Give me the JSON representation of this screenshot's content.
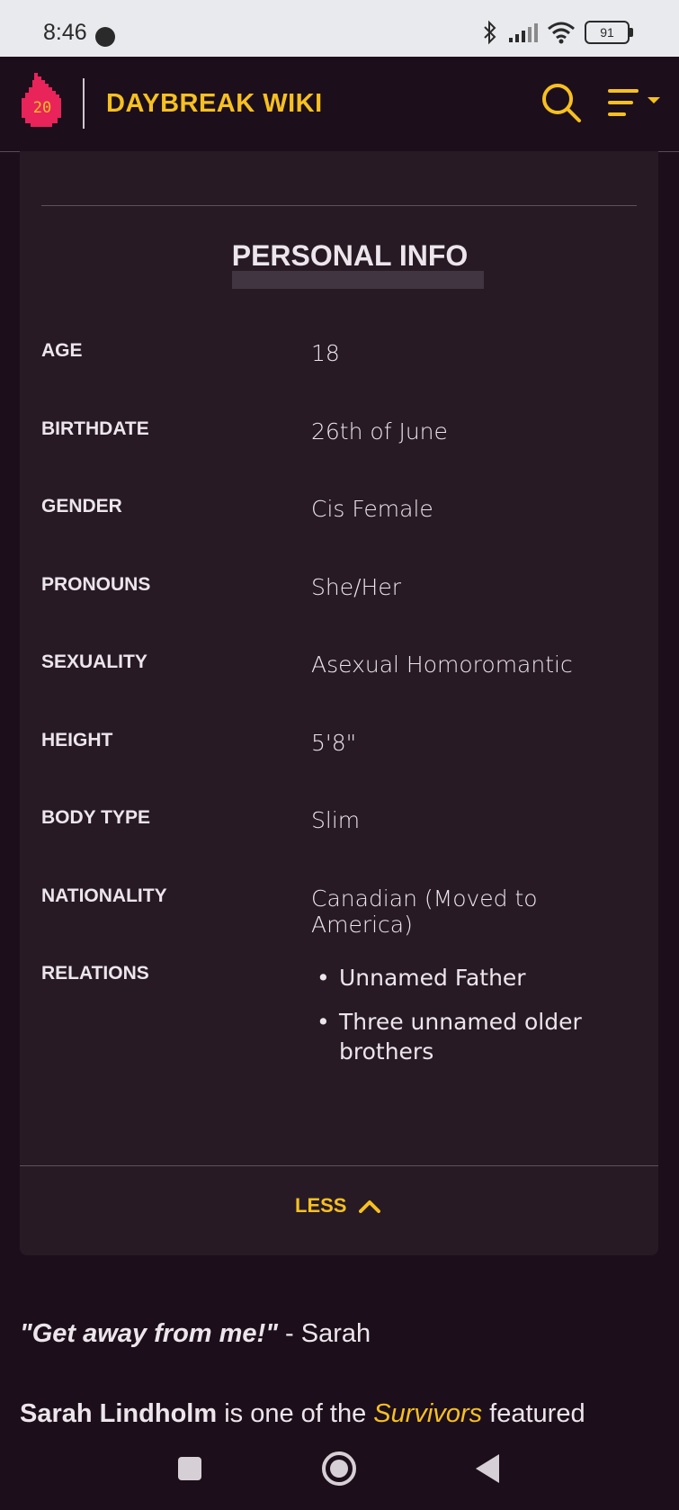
{
  "status": {
    "time": "8:46",
    "battery": "91"
  },
  "header": {
    "brand": "DAYBREAK WIKI",
    "logo_text": "20"
  },
  "infobox": {
    "title": "PERSONAL INFO",
    "rows": [
      {
        "label": "AGE",
        "value": "18"
      },
      {
        "label": "BIRTHDATE",
        "value": "26th of June"
      },
      {
        "label": "GENDER",
        "value": "Cis Female"
      },
      {
        "label": "PRONOUNS",
        "value": "She/Her"
      },
      {
        "label": "SEXUALITY",
        "value": "Asexual Homoromantic"
      },
      {
        "label": "HEIGHT",
        "value": "5'8\""
      },
      {
        "label": "BODY TYPE",
        "value": "Slim"
      },
      {
        "label": "NATIONALITY",
        "value": "Canadian (Moved to America)"
      }
    ],
    "relations_label": "RELATIONS",
    "relations": [
      "Unnamed Father",
      "Three unnamed older brothers"
    ],
    "less_label": "LESS"
  },
  "article": {
    "quote_text": "\"Get away from me!\"",
    "quote_attribution": " - Sarah",
    "intro_name": "Sarah Lindholm",
    "intro_mid": " is one of the ",
    "intro_link": "Survivors",
    "intro_end": " featured"
  },
  "colors": {
    "accent": "#f6c022",
    "background": "#1c0f1b",
    "card": "#271a25",
    "logo": "#e8245a"
  }
}
